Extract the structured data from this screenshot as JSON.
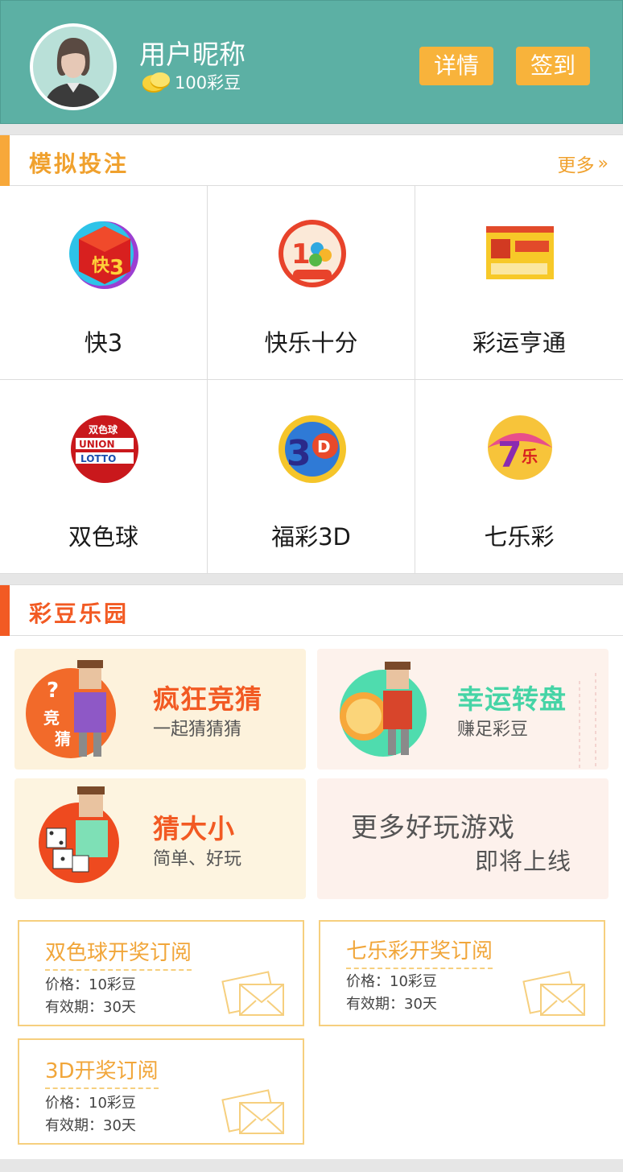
{
  "header": {
    "nickname": "用户昵称",
    "coins": "100彩豆",
    "detail_label": "详情",
    "sign_label": "签到"
  },
  "colors": {
    "teal": "#5cb0a4",
    "button": "#f8b33b",
    "orange": "#f0a12e",
    "red_orange": "#f25a23"
  },
  "section_bet": {
    "title": "模拟投注",
    "more_label": "更多",
    "games": [
      {
        "label": "快3",
        "icon": "kuai3-icon"
      },
      {
        "label": "快乐十分",
        "icon": "kuaile10-icon"
      },
      {
        "label": "彩运亨通",
        "icon": "caiyun-icon"
      },
      {
        "label": "双色球",
        "icon": "union-lotto-icon"
      },
      {
        "label": "福彩3D",
        "icon": "fucai3d-icon"
      },
      {
        "label": "七乐彩",
        "icon": "qilecai-icon"
      }
    ]
  },
  "section_park": {
    "title": "彩豆乐园",
    "cards": [
      {
        "title": "疯狂竞猜",
        "sub": "一起猜猜猜",
        "badge_line1": "竞",
        "badge_line2": "猜"
      },
      {
        "title": "幸运转盘",
        "sub": "赚足彩豆"
      },
      {
        "title": "猜大小",
        "sub": "简单、好玩"
      },
      {
        "line1": "更多好玩游戏",
        "line2": "即将上线"
      }
    ],
    "subscriptions": [
      {
        "title": "双色球开奖订阅",
        "price": "价格：10彩豆",
        "valid": "有效期：30天"
      },
      {
        "title": "七乐彩开奖订阅",
        "price": "价格：10彩豆",
        "valid": "有效期：30天"
      },
      {
        "title": "3D开奖订阅",
        "price": "价格：10彩豆",
        "valid": "有效期：30天"
      }
    ]
  }
}
